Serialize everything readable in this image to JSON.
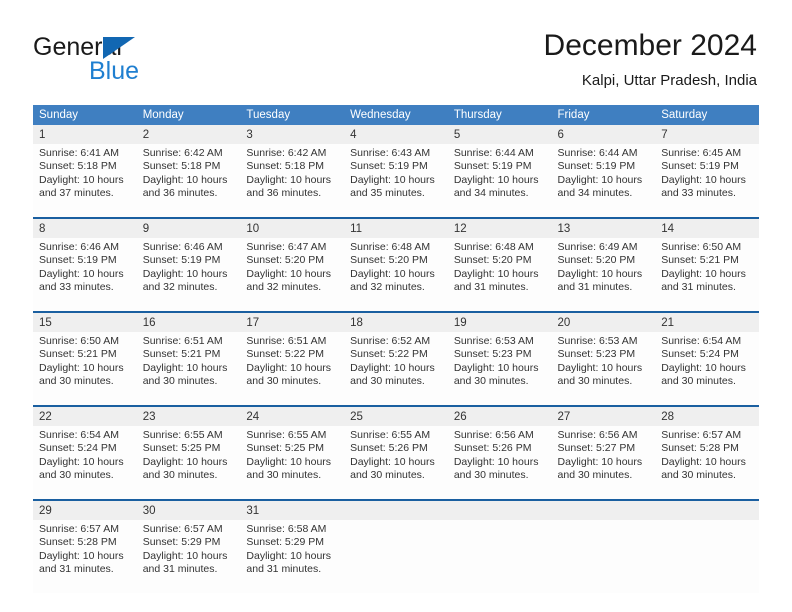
{
  "brand": {
    "word_one": "General",
    "word_two": "Blue",
    "triangle_icon": "brand-triangle-icon",
    "accent_color": "#1267b2",
    "blue_text_color": "#1f7fd0"
  },
  "header": {
    "title": "December 2024",
    "subtitle": "Kalpi, Uttar Pradesh, India"
  },
  "theme": {
    "header_row_bg": "#3f7fc1",
    "week_separator": "#1a5fa0",
    "daynum_bg": "#efefef",
    "cell_bg": "#fdfdfd",
    "text": "#333333"
  },
  "calendar": {
    "day_names": [
      "Sunday",
      "Monday",
      "Tuesday",
      "Wednesday",
      "Thursday",
      "Friday",
      "Saturday"
    ],
    "weeks": [
      [
        {
          "day": "1",
          "sunrise": "Sunrise: 6:41 AM",
          "sunset": "Sunset: 5:18 PM",
          "daylight_line1": "Daylight: 10 hours",
          "daylight_line2": "and 37 minutes."
        },
        {
          "day": "2",
          "sunrise": "Sunrise: 6:42 AM",
          "sunset": "Sunset: 5:18 PM",
          "daylight_line1": "Daylight: 10 hours",
          "daylight_line2": "and 36 minutes."
        },
        {
          "day": "3",
          "sunrise": "Sunrise: 6:42 AM",
          "sunset": "Sunset: 5:18 PM",
          "daylight_line1": "Daylight: 10 hours",
          "daylight_line2": "and 36 minutes."
        },
        {
          "day": "4",
          "sunrise": "Sunrise: 6:43 AM",
          "sunset": "Sunset: 5:19 PM",
          "daylight_line1": "Daylight: 10 hours",
          "daylight_line2": "and 35 minutes."
        },
        {
          "day": "5",
          "sunrise": "Sunrise: 6:44 AM",
          "sunset": "Sunset: 5:19 PM",
          "daylight_line1": "Daylight: 10 hours",
          "daylight_line2": "and 34 minutes."
        },
        {
          "day": "6",
          "sunrise": "Sunrise: 6:44 AM",
          "sunset": "Sunset: 5:19 PM",
          "daylight_line1": "Daylight: 10 hours",
          "daylight_line2": "and 34 minutes."
        },
        {
          "day": "7",
          "sunrise": "Sunrise: 6:45 AM",
          "sunset": "Sunset: 5:19 PM",
          "daylight_line1": "Daylight: 10 hours",
          "daylight_line2": "and 33 minutes."
        }
      ],
      [
        {
          "day": "8",
          "sunrise": "Sunrise: 6:46 AM",
          "sunset": "Sunset: 5:19 PM",
          "daylight_line1": "Daylight: 10 hours",
          "daylight_line2": "and 33 minutes."
        },
        {
          "day": "9",
          "sunrise": "Sunrise: 6:46 AM",
          "sunset": "Sunset: 5:19 PM",
          "daylight_line1": "Daylight: 10 hours",
          "daylight_line2": "and 32 minutes."
        },
        {
          "day": "10",
          "sunrise": "Sunrise: 6:47 AM",
          "sunset": "Sunset: 5:20 PM",
          "daylight_line1": "Daylight: 10 hours",
          "daylight_line2": "and 32 minutes."
        },
        {
          "day": "11",
          "sunrise": "Sunrise: 6:48 AM",
          "sunset": "Sunset: 5:20 PM",
          "daylight_line1": "Daylight: 10 hours",
          "daylight_line2": "and 32 minutes."
        },
        {
          "day": "12",
          "sunrise": "Sunrise: 6:48 AM",
          "sunset": "Sunset: 5:20 PM",
          "daylight_line1": "Daylight: 10 hours",
          "daylight_line2": "and 31 minutes."
        },
        {
          "day": "13",
          "sunrise": "Sunrise: 6:49 AM",
          "sunset": "Sunset: 5:20 PM",
          "daylight_line1": "Daylight: 10 hours",
          "daylight_line2": "and 31 minutes."
        },
        {
          "day": "14",
          "sunrise": "Sunrise: 6:50 AM",
          "sunset": "Sunset: 5:21 PM",
          "daylight_line1": "Daylight: 10 hours",
          "daylight_line2": "and 31 minutes."
        }
      ],
      [
        {
          "day": "15",
          "sunrise": "Sunrise: 6:50 AM",
          "sunset": "Sunset: 5:21 PM",
          "daylight_line1": "Daylight: 10 hours",
          "daylight_line2": "and 30 minutes."
        },
        {
          "day": "16",
          "sunrise": "Sunrise: 6:51 AM",
          "sunset": "Sunset: 5:21 PM",
          "daylight_line1": "Daylight: 10 hours",
          "daylight_line2": "and 30 minutes."
        },
        {
          "day": "17",
          "sunrise": "Sunrise: 6:51 AM",
          "sunset": "Sunset: 5:22 PM",
          "daylight_line1": "Daylight: 10 hours",
          "daylight_line2": "and 30 minutes."
        },
        {
          "day": "18",
          "sunrise": "Sunrise: 6:52 AM",
          "sunset": "Sunset: 5:22 PM",
          "daylight_line1": "Daylight: 10 hours",
          "daylight_line2": "and 30 minutes."
        },
        {
          "day": "19",
          "sunrise": "Sunrise: 6:53 AM",
          "sunset": "Sunset: 5:23 PM",
          "daylight_line1": "Daylight: 10 hours",
          "daylight_line2": "and 30 minutes."
        },
        {
          "day": "20",
          "sunrise": "Sunrise: 6:53 AM",
          "sunset": "Sunset: 5:23 PM",
          "daylight_line1": "Daylight: 10 hours",
          "daylight_line2": "and 30 minutes."
        },
        {
          "day": "21",
          "sunrise": "Sunrise: 6:54 AM",
          "sunset": "Sunset: 5:24 PM",
          "daylight_line1": "Daylight: 10 hours",
          "daylight_line2": "and 30 minutes."
        }
      ],
      [
        {
          "day": "22",
          "sunrise": "Sunrise: 6:54 AM",
          "sunset": "Sunset: 5:24 PM",
          "daylight_line1": "Daylight: 10 hours",
          "daylight_line2": "and 30 minutes."
        },
        {
          "day": "23",
          "sunrise": "Sunrise: 6:55 AM",
          "sunset": "Sunset: 5:25 PM",
          "daylight_line1": "Daylight: 10 hours",
          "daylight_line2": "and 30 minutes."
        },
        {
          "day": "24",
          "sunrise": "Sunrise: 6:55 AM",
          "sunset": "Sunset: 5:25 PM",
          "daylight_line1": "Daylight: 10 hours",
          "daylight_line2": "and 30 minutes."
        },
        {
          "day": "25",
          "sunrise": "Sunrise: 6:55 AM",
          "sunset": "Sunset: 5:26 PM",
          "daylight_line1": "Daylight: 10 hours",
          "daylight_line2": "and 30 minutes."
        },
        {
          "day": "26",
          "sunrise": "Sunrise: 6:56 AM",
          "sunset": "Sunset: 5:26 PM",
          "daylight_line1": "Daylight: 10 hours",
          "daylight_line2": "and 30 minutes."
        },
        {
          "day": "27",
          "sunrise": "Sunrise: 6:56 AM",
          "sunset": "Sunset: 5:27 PM",
          "daylight_line1": "Daylight: 10 hours",
          "daylight_line2": "and 30 minutes."
        },
        {
          "day": "28",
          "sunrise": "Sunrise: 6:57 AM",
          "sunset": "Sunset: 5:28 PM",
          "daylight_line1": "Daylight: 10 hours",
          "daylight_line2": "and 30 minutes."
        }
      ],
      [
        {
          "day": "29",
          "sunrise": "Sunrise: 6:57 AM",
          "sunset": "Sunset: 5:28 PM",
          "daylight_line1": "Daylight: 10 hours",
          "daylight_line2": "and 31 minutes."
        },
        {
          "day": "30",
          "sunrise": "Sunrise: 6:57 AM",
          "sunset": "Sunset: 5:29 PM",
          "daylight_line1": "Daylight: 10 hours",
          "daylight_line2": "and 31 minutes."
        },
        {
          "day": "31",
          "sunrise": "Sunrise: 6:58 AM",
          "sunset": "Sunset: 5:29 PM",
          "daylight_line1": "Daylight: 10 hours",
          "daylight_line2": "and 31 minutes."
        },
        {
          "day": "",
          "sunrise": "",
          "sunset": "",
          "daylight_line1": "",
          "daylight_line2": ""
        },
        {
          "day": "",
          "sunrise": "",
          "sunset": "",
          "daylight_line1": "",
          "daylight_line2": ""
        },
        {
          "day": "",
          "sunrise": "",
          "sunset": "",
          "daylight_line1": "",
          "daylight_line2": ""
        },
        {
          "day": "",
          "sunrise": "",
          "sunset": "",
          "daylight_line1": "",
          "daylight_line2": ""
        }
      ]
    ]
  }
}
